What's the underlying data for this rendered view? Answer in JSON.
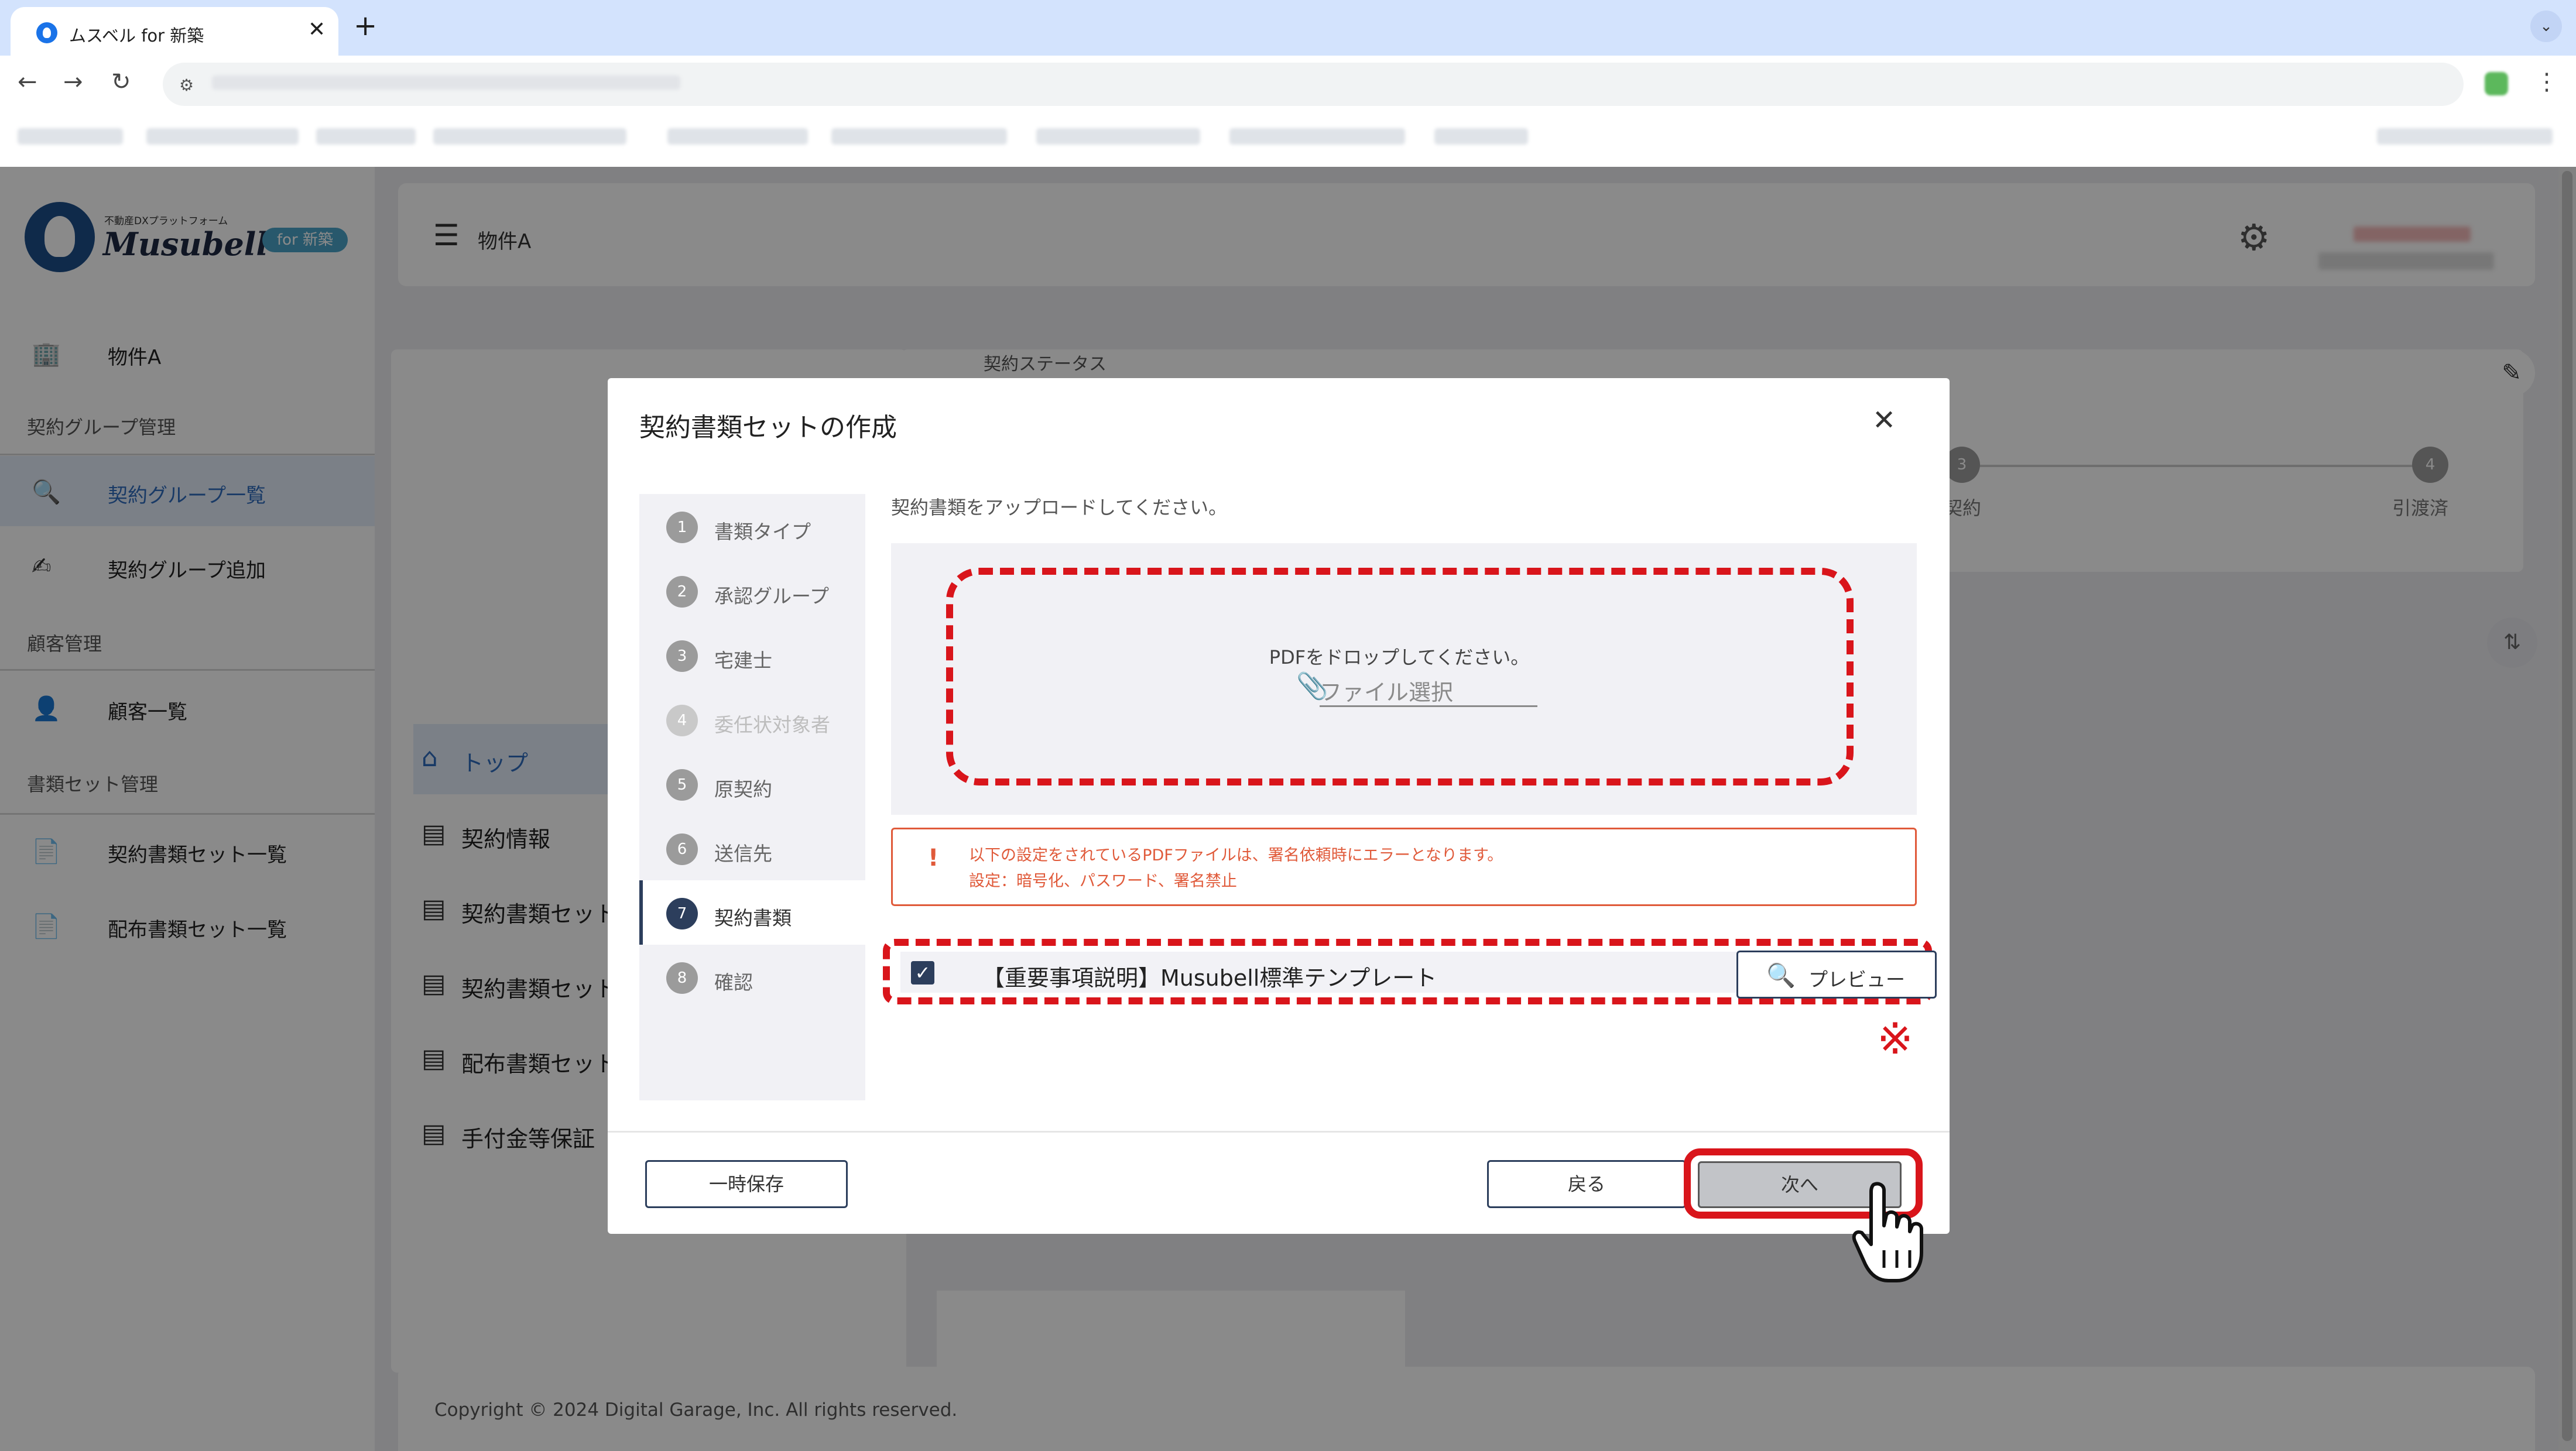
{
  "browser": {
    "tab_title": "ムスベル for 新築",
    "close_glyph": "✕",
    "new_tab_glyph": "+",
    "tabs_menu_glyph": "⌄"
  },
  "sidebar": {
    "logo_small": "不動産DXプラットフォーム",
    "logo_name": "Musubell",
    "logo_badge": "for 新築",
    "property_item": "物件A",
    "section_contract_group": "契約グループ管理",
    "item_group_list": "契約グループ一覧",
    "item_group_add": "契約グループ追加",
    "section_customer": "顧客管理",
    "item_customer_list": "顧客一覧",
    "section_docset": "書類セット管理",
    "item_contract_docset_list": "契約書類セット一覧",
    "item_dist_docset_list": "配布書類セット一覧"
  },
  "header": {
    "title": "物件A"
  },
  "background": {
    "status_label": "契約ステータス",
    "step3": "3",
    "step3_label": "契約",
    "step4": "4",
    "step4_label": "引渡済",
    "nav_top": "トップ",
    "nav_contract_info": "契約情報",
    "nav_contract_docset1": "契約書類セット",
    "nav_contract_docset2": "契約書類セット",
    "nav_dist_docset": "配布書類セット",
    "nav_deposit": "手付金等保証",
    "copyright": "Copyright © 2024 Digital Garage, Inc. All rights reserved."
  },
  "modal": {
    "title": "契約書類セットの作成",
    "close_glyph": "✕",
    "steps": [
      {
        "num": "1",
        "label": "書類タイプ"
      },
      {
        "num": "2",
        "label": "承認グループ"
      },
      {
        "num": "3",
        "label": "宅建士"
      },
      {
        "num": "4",
        "label": "委任状対象者"
      },
      {
        "num": "5",
        "label": "原契約"
      },
      {
        "num": "6",
        "label": "送信先"
      },
      {
        "num": "7",
        "label": "契約書類"
      },
      {
        "num": "8",
        "label": "確認"
      }
    ],
    "instruction": "契約書類をアップロードしてください。",
    "drop_text": "PDFをドロップしてください。",
    "file_select": "ファイル選択",
    "alert_mark": "!",
    "alert_line1": "以下の設定をされているPDFファイルは、署名依頼時にエラーとなります。",
    "alert_line2": "設定：暗号化、パスワード、署名禁止",
    "document_name": "【重要事項説明】Musubell標準テンプレート",
    "preview_label": "プレビュー",
    "note_mark": "※",
    "save_draft": "一時保存",
    "back": "戻る",
    "next": "次へ"
  },
  "colors": {
    "annotation_red": "#d9151b",
    "primary_navy": "#2c3e5c",
    "alert_orange": "#e05a3a",
    "active_blue": "#2f6bbd"
  }
}
